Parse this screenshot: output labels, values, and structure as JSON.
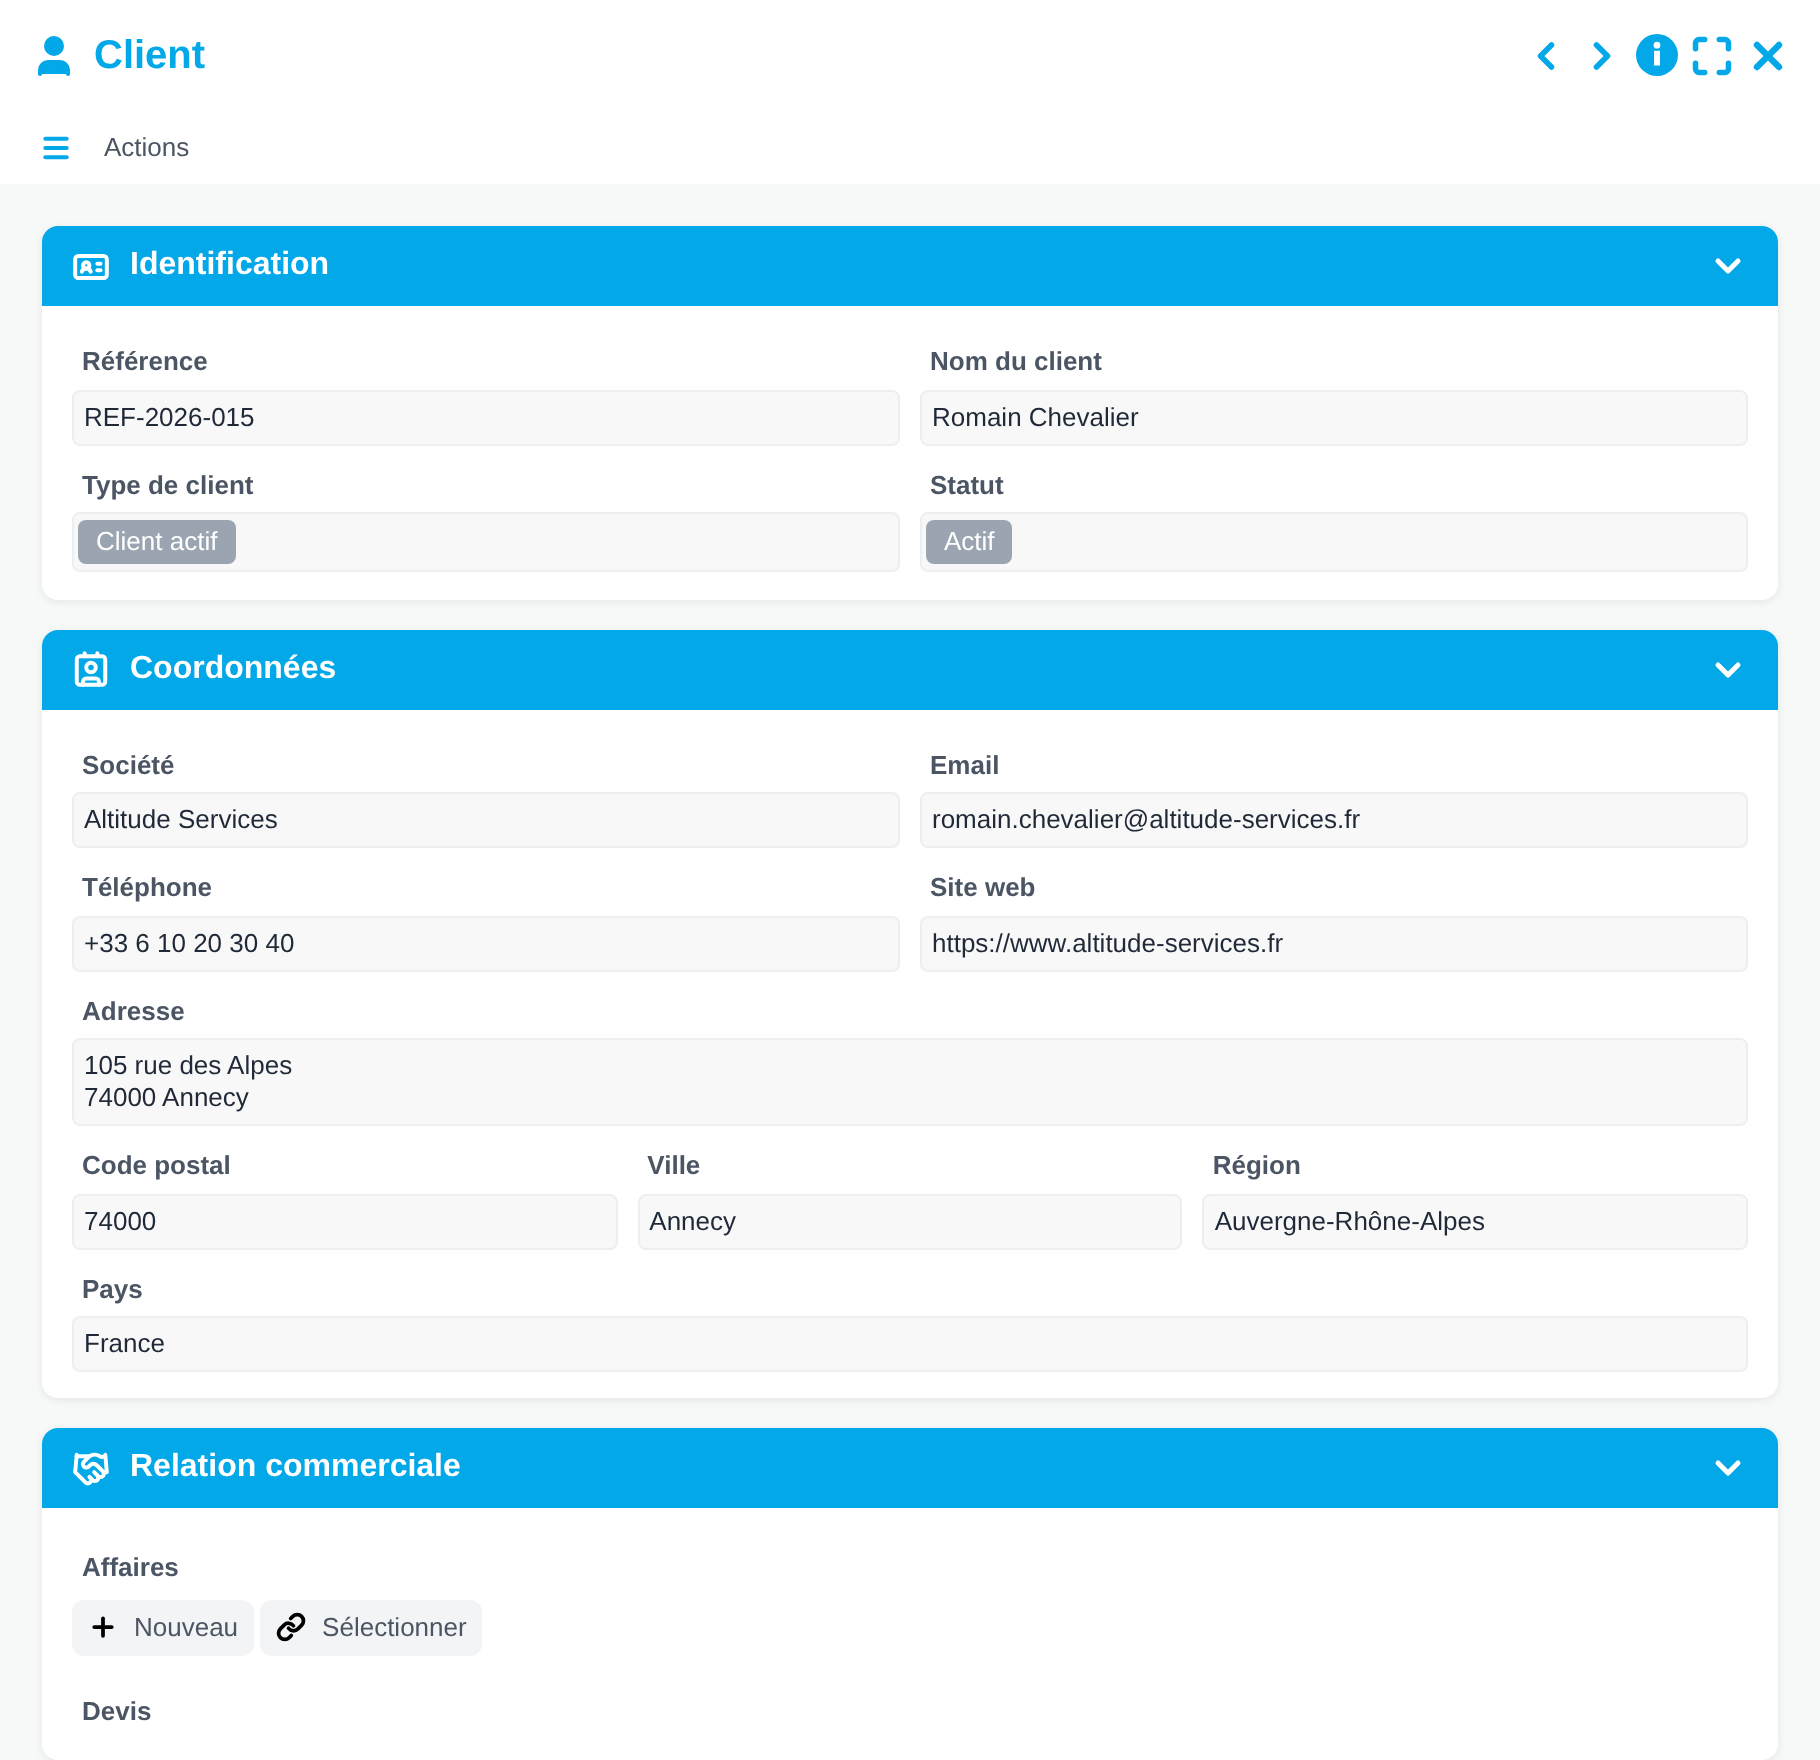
{
  "window": {
    "title": "Client"
  },
  "toolbar": {
    "menu_label": "Actions"
  },
  "sections": [
    {
      "kind": "fields",
      "title": "Identification",
      "expanded": true,
      "rows": [
        [
          {
            "kind": "text",
            "label": "Référence",
            "value": "REF-2026-015"
          },
          {
            "kind": "text",
            "label": "Nom du client",
            "value": "Romain Chevalier"
          }
        ],
        [
          {
            "kind": "badge",
            "label": "Type de client",
            "value": "Client actif"
          },
          {
            "kind": "badge",
            "label": "Statut",
            "value": "Actif"
          }
        ]
      ]
    },
    {
      "kind": "fields",
      "title": "Coordonnées",
      "expanded": true,
      "rows": [
        [
          {
            "kind": "text",
            "label": "Société",
            "value": "Altitude Services"
          },
          {
            "kind": "text",
            "label": "Email",
            "value": "romain.chevalier@altitude-services.fr"
          }
        ],
        [
          {
            "kind": "text",
            "label": "Téléphone",
            "value": "+33 6 10 20 30 40"
          },
          {
            "kind": "text",
            "label": "Site web",
            "value": "https://www.altitude-services.fr"
          }
        ],
        [
          {
            "kind": "textarea",
            "label": "Adresse",
            "lines": [
              "105 rue des Alpes",
              "74000 Annecy"
            ]
          }
        ],
        [
          {
            "kind": "text",
            "label": "Code postal",
            "value": "74000"
          },
          {
            "kind": "text",
            "label": "Ville",
            "value": "Annecy"
          },
          {
            "kind": "text",
            "label": "Région",
            "value": "Auvergne-Rhône-Alpes"
          }
        ],
        [
          {
            "kind": "text",
            "label": "Pays",
            "value": "France"
          }
        ]
      ]
    },
    {
      "kind": "relations",
      "title": "Relation commerciale",
      "expanded": true,
      "groups": [
        {
          "label": "Affaires",
          "buttons": [
            {
              "kind": "new",
              "label": "Nouveau"
            },
            {
              "kind": "select",
              "label": "Sélectionner"
            }
          ]
        },
        {
          "label": "Devis"
        }
      ]
    }
  ]
}
